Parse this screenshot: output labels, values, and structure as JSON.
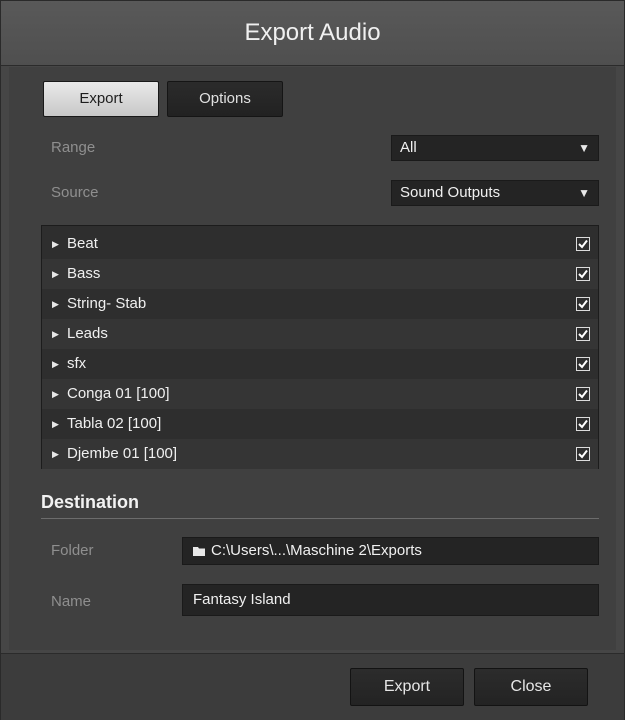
{
  "dialog": {
    "title": "Export Audio"
  },
  "tabs": {
    "export_label": "Export",
    "options_label": "Options",
    "active": "Export"
  },
  "range": {
    "label": "Range",
    "value": "All"
  },
  "source": {
    "label": "Source",
    "value": "Sound Outputs"
  },
  "outputs": [
    {
      "name": "Beat",
      "checked": true
    },
    {
      "name": "Bass",
      "checked": true
    },
    {
      "name": "String- Stab",
      "checked": true
    },
    {
      "name": "Leads",
      "checked": true
    },
    {
      "name": "sfx",
      "checked": true
    },
    {
      "name": "Conga 01 [100]",
      "checked": true
    },
    {
      "name": "Tabla 02 [100]",
      "checked": true
    },
    {
      "name": "Djembe 01 [100]",
      "checked": true
    }
  ],
  "destination": {
    "title": "Destination",
    "folder_label": "Folder",
    "folder_value": "C:\\Users\\...\\Maschine 2\\Exports",
    "name_label": "Name",
    "name_value": "Fantasy Island"
  },
  "footer": {
    "export_label": "Export",
    "close_label": "Close"
  },
  "icons": {
    "folder": "folder-icon",
    "dropdown": "triangle-down-icon",
    "expand": "triangle-right-icon",
    "check": "checkmark-icon"
  }
}
